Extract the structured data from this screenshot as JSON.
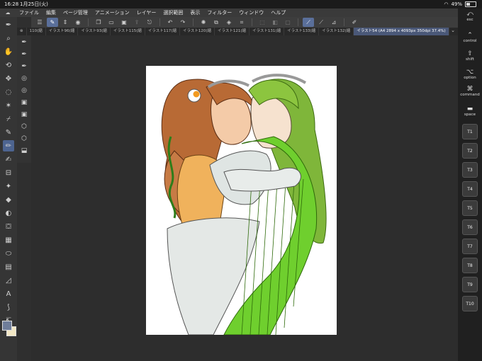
{
  "status": {
    "time": "16:28",
    "date": "1月25日(火)",
    "battery": "49%"
  },
  "menu": {
    "items": [
      "ファイル",
      "編集",
      "ページ管理",
      "アニメーション",
      "レイヤー",
      "選択範囲",
      "表示",
      "フィルター",
      "ウィンドウ",
      "ヘルプ"
    ]
  },
  "tabs": {
    "items": [
      "110(縮",
      "イラスト96(縮",
      "イラスト93(縮",
      "イラスト115(縮",
      "イラスト117(縮",
      "イラスト120(縮",
      "イラスト121(縮",
      "イラスト131(縮",
      "イラスト133(縮",
      "イラスト132(縮"
    ],
    "active": "イラスト54 (A4 2894 x 4093px 350dpi 37.4%)"
  },
  "rightbar": {
    "esc": "esc",
    "control": "control",
    "shift": "shift",
    "option": "option",
    "command": "command",
    "space": "space",
    "tkeys": [
      "T1",
      "T2",
      "T3",
      "T4",
      "T5",
      "T6",
      "T7",
      "T8",
      "T9",
      "T10"
    ]
  },
  "icons": {
    "app": "clip-studio-icon",
    "wifi": "wifi-icon",
    "battery": "battery-icon"
  },
  "colors": {
    "main": "#6f7d9a",
    "sub": "#f2e7c5",
    "accent": "#5a6f9a"
  }
}
